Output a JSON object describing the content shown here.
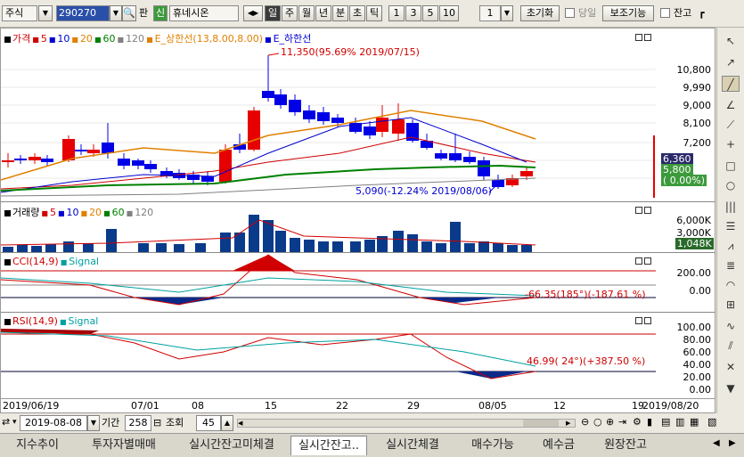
{
  "toolbar": {
    "market": "주식",
    "code": "290270",
    "pan_label": "판",
    "sin_label": "신",
    "stock_name": "휴네시온",
    "periods": [
      "일",
      "주",
      "월",
      "년",
      "분",
      "초",
      "틱"
    ],
    "active_period": "일",
    "nums": [
      "1",
      "3",
      "5",
      "10"
    ],
    "count": "1",
    "reset_label": "초기화",
    "today_label": "당일",
    "assist_label": "보조기능",
    "balance_label": "잔고"
  },
  "price_pane": {
    "legend": [
      {
        "text": "가격",
        "color": "#d00000"
      },
      {
        "text": "5",
        "color": "#d00000"
      },
      {
        "text": "10",
        "color": "#0000d0"
      },
      {
        "text": "20",
        "color": "#e08000"
      },
      {
        "text": "60",
        "color": "#008000"
      },
      {
        "text": "120",
        "color": "#808080"
      },
      {
        "text": "E_상한선(13,8.00,8.00)",
        "color": "#e08000"
      },
      {
        "text": "E_하한선",
        "color": "#0000d0"
      }
    ],
    "y_labels": [
      "10,800",
      "9,990",
      "9,000",
      "8,100",
      "7,200",
      "6,300",
      "5,800"
    ],
    "current_price": "6,360",
    "current_pct": "( 0.00%)",
    "high_annotation": "11,350(95.69% 2019/07/15)",
    "low_annotation": "5,090(-12.24% 2019/08/06)"
  },
  "volume_pane": {
    "legend": [
      {
        "text": "거래량",
        "color": "#000000"
      },
      {
        "text": "5",
        "color": "#d00000"
      },
      {
        "text": "10",
        "color": "#0000d0"
      },
      {
        "text": "20",
        "color": "#e08000"
      },
      {
        "text": "60",
        "color": "#008000"
      },
      {
        "text": "120",
        "color": "#808080"
      }
    ],
    "y_labels": [
      "6,000K",
      "3,000K"
    ],
    "current": "1,048K"
  },
  "cci_pane": {
    "legend": [
      {
        "text": "CCI(14,9)",
        "color": "#d00000"
      },
      {
        "text": "Signal",
        "color": "#00a0a0"
      }
    ],
    "y_labels": [
      "200.00",
      "0.00"
    ],
    "annotation": "-66.35(185°)(-187.61 %)"
  },
  "rsi_pane": {
    "legend": [
      {
        "text": "RSI(14,9)",
        "color": "#d00000"
      },
      {
        "text": "Signal",
        "color": "#00a0a0"
      }
    ],
    "y_labels": [
      "100.00",
      "80.00",
      "60.00",
      "40.00",
      "20.00",
      "0.00"
    ],
    "annotation": "46.99( 24°)(+387.50 %)"
  },
  "x_axis": {
    "labels": [
      "2019/06/19",
      "07/01",
      "08",
      "15",
      "22",
      "29",
      "08/05",
      "12",
      "19",
      "2019/08/20"
    ]
  },
  "bottom_bar": {
    "date": "2019-08-08",
    "period_label": "기간",
    "period_value": "258",
    "view_label": "조회",
    "view_value": "45"
  },
  "tabs": [
    "지수추이",
    "투자자별매매",
    "실시간잔고미체결",
    "실시간잔고..",
    "실시간체결",
    "매수가능",
    "예수금",
    "원장잔고"
  ],
  "active_tab": "실시간잔고..",
  "colors": {
    "up": "#e60000",
    "down": "#0000e6",
    "ma20": "#e08000",
    "ma60": "#008000"
  }
}
